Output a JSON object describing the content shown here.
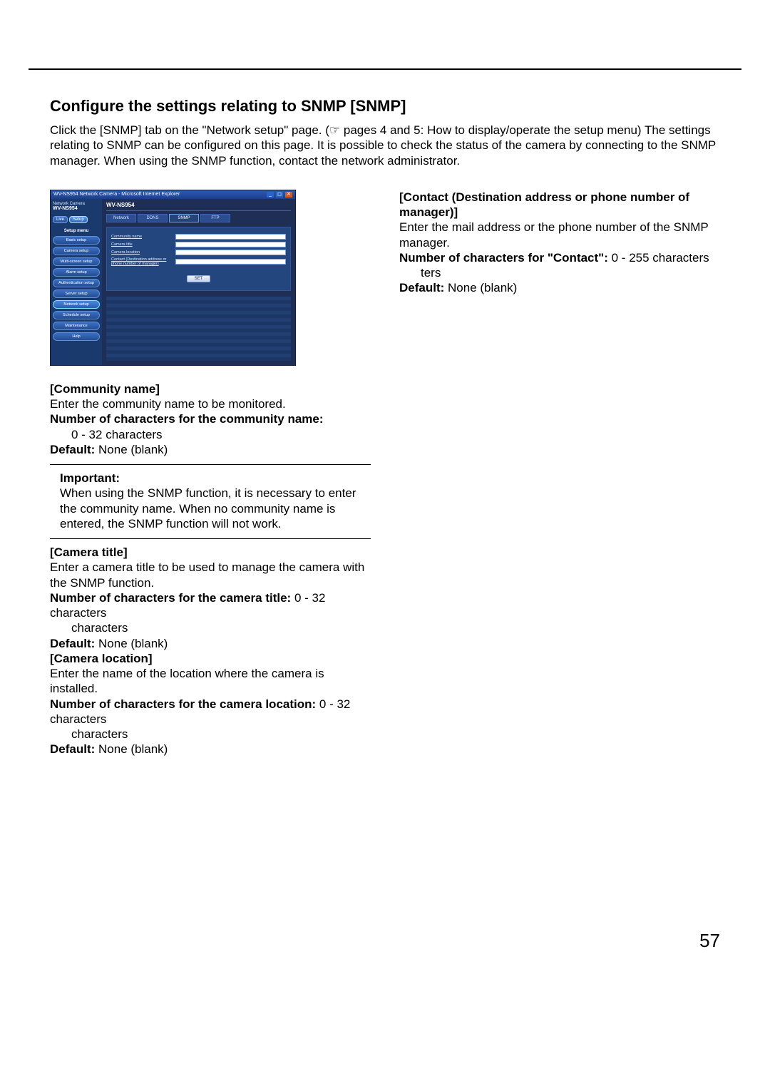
{
  "page_title": "Configure the settings relating to SNMP [SNMP]",
  "intro": "Click the [SNMP] tab on the \"Network setup\" page. (☞ pages 4 and 5: How to display/operate the setup menu) The settings relating to SNMP can be configured on this page. It is possible to check the status of the camera by connecting to the SNMP manager. When using the SNMP function, contact the network administrator.",
  "page_number": "57",
  "shot": {
    "window_title": "WV-NS954 Network Camera - Microsoft Internet Explorer",
    "brand_sub": "Network Camera",
    "brand_main": "WV-NS954",
    "top_buttons": {
      "live": "Live",
      "setup": "Setup"
    },
    "menu_heading": "Setup menu",
    "nav": [
      "Basic setup",
      "Camera setup",
      "Multi-screen setup",
      "Alarm setup",
      "Authentication setup",
      "Server setup",
      "Network setup",
      "Schedule setup",
      "Maintenance",
      "Help"
    ],
    "main_title": "WV-NS954",
    "tabs": [
      "Network",
      "DDNS",
      "SNMP",
      "FTP"
    ],
    "fields": [
      "Community name",
      "Camera title",
      "Camera location",
      "Contact (Destination address or phone number of manager)"
    ],
    "set_button": "SET"
  },
  "left": {
    "community": {
      "heading": "[Community name]",
      "desc": "Enter the community name to be monitored.",
      "limit_label": "Number of characters for the community name:",
      "limit_value": "0 - 32 characters",
      "default_label": "Default:",
      "default_value": " None (blank)"
    },
    "important": {
      "heading": "Important:",
      "body": "When using the SNMP function, it is necessary to enter the community name. When no community name is entered, the SNMP function will not work."
    },
    "camera_title": {
      "heading": "[Camera title]",
      "desc": "Enter a camera title to be used to manage the camera with the SNMP function.",
      "limit_label": "Number of characters for the camera title:",
      "limit_value": " 0 - 32 characters",
      "default_label": "Default:",
      "default_value": " None (blank)"
    },
    "camera_location": {
      "heading": "[Camera location]",
      "desc": "Enter the name of the location where the camera is installed.",
      "limit_label": "Number of characters for the camera location:",
      "limit_value": " 0 - 32 characters",
      "default_label": "Default:",
      "default_value": " None (blank)"
    }
  },
  "right": {
    "contact": {
      "heading": "[Contact (Destination address or phone number of manager)]",
      "desc": "Enter the mail address or the phone number of the SNMP manager.",
      "limit_label": "Number of characters for \"Contact\":",
      "limit_value": " 0 - 255 characters",
      "default_label": "Default:",
      "default_value": " None (blank)"
    }
  }
}
